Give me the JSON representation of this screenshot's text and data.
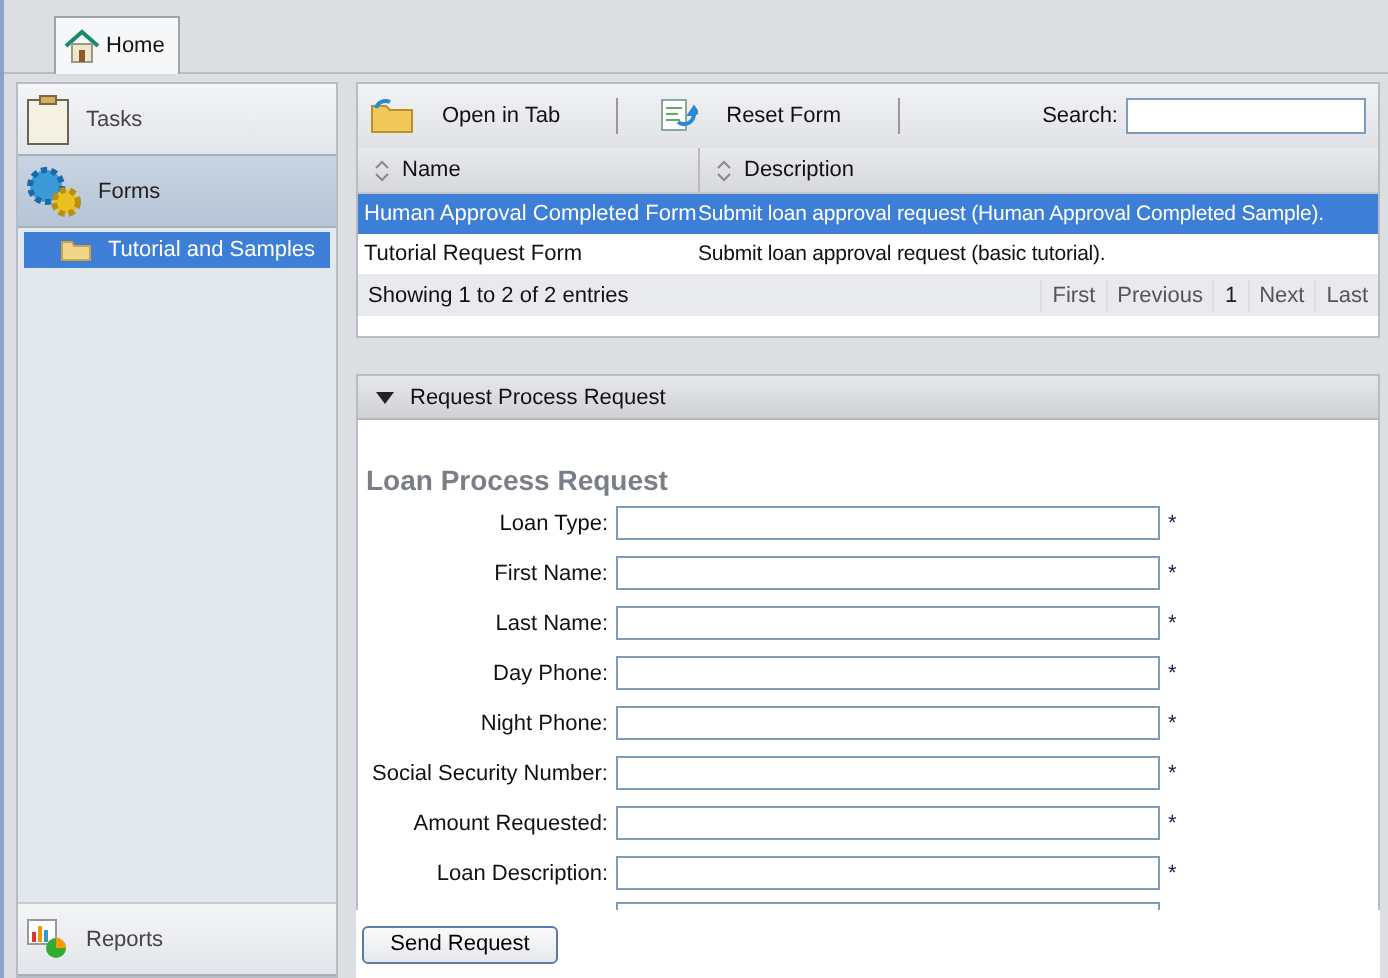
{
  "tabs": [
    {
      "label": "Home",
      "selected": true
    }
  ],
  "sidebar": {
    "sections": [
      {
        "label": "Tasks",
        "selected": false
      },
      {
        "label": "Forms",
        "selected": true,
        "children": [
          {
            "label": "Tutorial and Samples",
            "selected": true
          }
        ]
      }
    ],
    "bottom": {
      "label": "Reports"
    }
  },
  "toolbar": {
    "buttons": [
      {
        "label": "Open in Tab"
      },
      {
        "label": "Reset Form"
      }
    ],
    "search_label": "Search:"
  },
  "table": {
    "columns": [
      "Name",
      "Description"
    ],
    "rows": [
      {
        "cells": [
          "Human Approval Completed Form",
          "Submit loan approval request (Human Approval Completed Sample)."
        ],
        "selected": true
      },
      {
        "cells": [
          "Tutorial Request Form",
          "Submit loan approval request (basic tutorial)."
        ],
        "selected": false
      }
    ],
    "summary": "Showing 1 to 2 of 2 entries",
    "pager": [
      {
        "label": "First",
        "selected": false
      },
      {
        "label": "Previous",
        "selected": false
      },
      {
        "label": "1",
        "selected": true
      },
      {
        "label": "Next",
        "selected": false
      },
      {
        "label": "Last",
        "selected": false
      }
    ]
  },
  "form_panel": {
    "title": "Request Process Request",
    "expanded": true,
    "heading": "Loan Process Request",
    "fields": [
      {
        "label": "Loan Type:",
        "marker": "*"
      },
      {
        "label": "First Name:",
        "marker": "*"
      },
      {
        "label": "Last Name:",
        "marker": "*"
      },
      {
        "label": "Day Phone:",
        "marker": "*"
      },
      {
        "label": "Night Phone:",
        "marker": "*"
      },
      {
        "label": "Social Security Number:",
        "marker": "*"
      },
      {
        "label": "Amount Requested:",
        "marker": "*"
      },
      {
        "label": "Loan Description:",
        "marker": "*"
      }
    ],
    "submit": "Send Request"
  }
}
